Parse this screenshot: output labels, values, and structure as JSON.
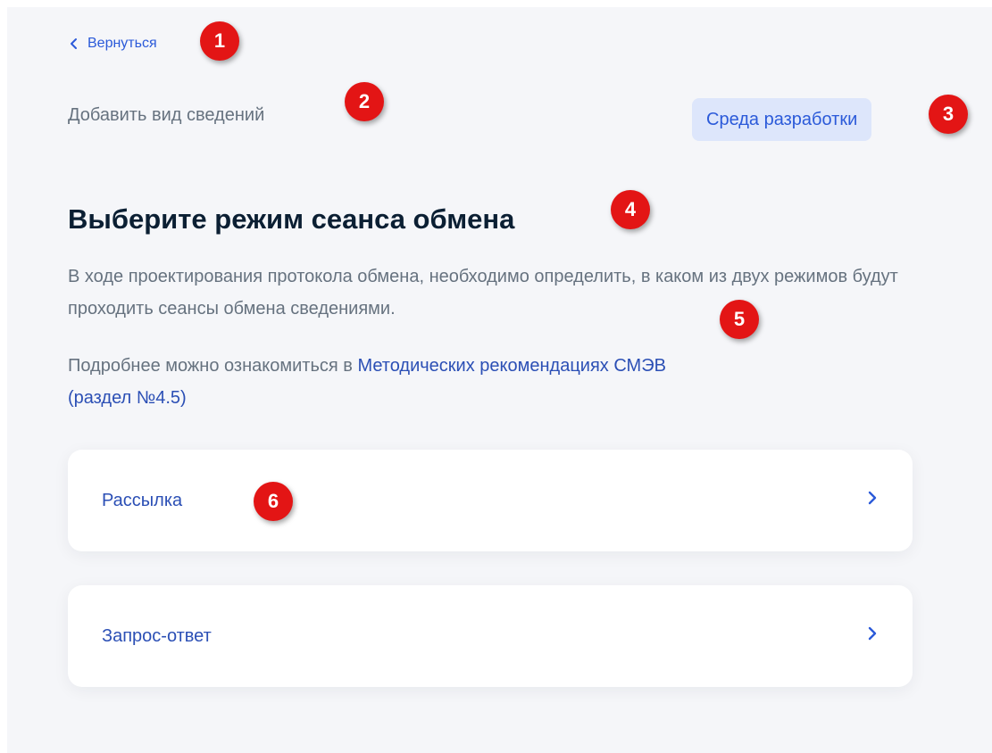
{
  "nav": {
    "back_label": "Вернуться"
  },
  "header": {
    "subtitle": "Добавить вид сведений",
    "environment_badge": "Среда разработки"
  },
  "main": {
    "title": "Выберите режим сеанса обмена",
    "description": "В ходе проектирования протокола обмена, необходимо определить, в каком из двух режимов будут проходить сеансы обмена сведениями.",
    "more_prefix": "Подробнее можно ознакомиться в ",
    "more_link": "Методических рекомендациях СМЭВ",
    "more_suffix": "(раздел №4.5)",
    "options": [
      {
        "label": "Рассылка"
      },
      {
        "label": "Запрос-ответ"
      }
    ]
  },
  "annotations": [
    "1",
    "2",
    "3",
    "4",
    "5",
    "6"
  ],
  "colors": {
    "accent": "#2b5ad9",
    "link": "#2b4fb5",
    "title": "#0b1f33",
    "muted_text": "#66727f",
    "badge_bg": "#dde6fb",
    "page_bg": "#f5f6f9",
    "marker": "#e31515"
  }
}
